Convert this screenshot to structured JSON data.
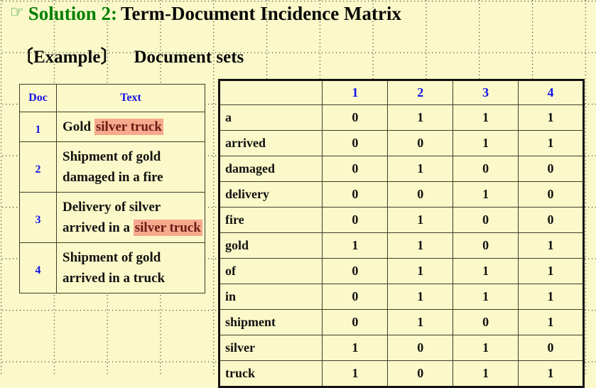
{
  "slide": {
    "background_color": "#fbf9c9",
    "title": {
      "icon": "pointing-hand-icon",
      "icon_glyph": "☞",
      "icon_color": "#008000",
      "green_part": "Solution 2:",
      "black_part": "Term-Document Incidence Matrix"
    },
    "subtitle": {
      "bracketed": "〔Example〕",
      "text": "Document sets"
    }
  },
  "doc_table": {
    "headers": [
      "Doc",
      "Text"
    ],
    "header_color": "#1414e6",
    "highlight_bg": "#f7a98d",
    "highlight_fg": "#6b1b14",
    "rows": [
      {
        "doc": "1",
        "segments": [
          {
            "text": "Gold ",
            "highlight": false
          },
          {
            "text": "silver truck",
            "highlight": true
          }
        ]
      },
      {
        "doc": "2",
        "segments": [
          {
            "text": "Shipment of gold damaged in a fire",
            "highlight": false
          }
        ]
      },
      {
        "doc": "3",
        "segments": [
          {
            "text": "Delivery of silver arrived in a ",
            "highlight": false
          },
          {
            "text": "silver truck",
            "highlight": true
          }
        ]
      },
      {
        "doc": "4",
        "segments": [
          {
            "text": "Shipment of gold arrived in a truck",
            "highlight": false
          }
        ]
      }
    ]
  },
  "matrix": {
    "corner_label": "",
    "doc_columns": [
      "1",
      "2",
      "3",
      "4"
    ],
    "doc_column_color": "#1414e6",
    "terms": [
      "a",
      "arrived",
      "damaged",
      "delivery",
      "fire",
      "gold",
      "of",
      "in",
      "shipment",
      "silver",
      "truck"
    ],
    "values": [
      [
        0,
        1,
        1,
        1
      ],
      [
        0,
        0,
        1,
        1
      ],
      [
        0,
        1,
        0,
        0
      ],
      [
        0,
        0,
        1,
        0
      ],
      [
        0,
        1,
        0,
        0
      ],
      [
        1,
        1,
        0,
        1
      ],
      [
        0,
        1,
        1,
        1
      ],
      [
        0,
        1,
        1,
        1
      ],
      [
        0,
        1,
        0,
        1
      ],
      [
        1,
        0,
        1,
        0
      ],
      [
        1,
        0,
        1,
        1
      ]
    ]
  }
}
